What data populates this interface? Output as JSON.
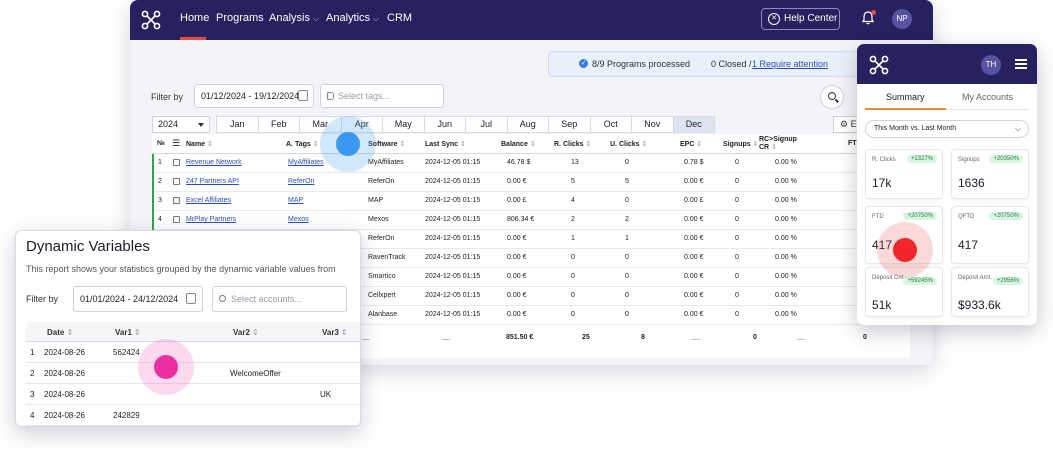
{
  "topnav": {
    "items": [
      {
        "label": "Home",
        "dropdown": false
      },
      {
        "label": "Programs",
        "dropdown": false
      },
      {
        "label": "Analysis",
        "dropdown": true
      },
      {
        "label": "Analytics",
        "dropdown": true
      },
      {
        "label": "CRM",
        "dropdown": false
      }
    ],
    "help_label": "Help Center",
    "avatar_initials": "NP",
    "nav_bg": "#26215f",
    "accent": "#e74b3c"
  },
  "status": {
    "processed": "8/9 Programs processed",
    "closed": "0 Closed /",
    "attention": "1 Require attention"
  },
  "filters": {
    "label": "Filter by",
    "date_range": "01/12/2024 - 19/12/2024",
    "tags_placeholder": "Select tags...",
    "year": "2024"
  },
  "months": [
    "Jan",
    "Feb",
    "Mar",
    "Apr",
    "May",
    "Jun",
    "Jul",
    "Aug",
    "Sep",
    "Oct",
    "Nov",
    "Dec"
  ],
  "active_month": "Dec",
  "export_label": "E",
  "table": {
    "headers": {
      "num": "№",
      "name": "Name",
      "tags": "A. Tags",
      "software": "Software",
      "sync": "Last Sync",
      "balance": "Balance",
      "rclicks": "R. Clicks",
      "uclicks": "U. Clicks",
      "epc": "EPC",
      "signups": "Signups",
      "rccr": "RC>Signup CR",
      "ftd": "FTD"
    },
    "rows": [
      {
        "n": "1",
        "name": "Revenue Network",
        "tag": "MyAffiliates",
        "software": "MyAffiliates",
        "sync": "2024-12-05 01:15",
        "balance": "46.78 $",
        "rclicks": "13",
        "uclicks": "0",
        "epc": "0.78 $",
        "signups": "0",
        "cr": "0.00 %",
        "checkbox": true
      },
      {
        "n": "2",
        "name": "247 Partners API",
        "tag": "ReferOn",
        "software": "ReferOn",
        "sync": "2024-12-05 01:15",
        "balance": "0.00 €",
        "rclicks": "5",
        "uclicks": "5",
        "epc": "0.00 €",
        "signups": "0",
        "cr": "0.00 %",
        "checkbox": true
      },
      {
        "n": "3",
        "name": "Excel Affiliates",
        "tag": "MAP",
        "software": "MAP",
        "sync": "2024-12-05 01:15",
        "balance": "0.00 £",
        "rclicks": "4",
        "uclicks": "0",
        "epc": "0.00 £",
        "signups": "0",
        "cr": "0.00 %",
        "checkbox": true
      },
      {
        "n": "4",
        "name": "MrPlay Partners",
        "tag": "Mexos",
        "software": "Mexos",
        "sync": "2024-12-05 01:15",
        "balance": "806.34 €",
        "rclicks": "2",
        "uclicks": "2",
        "epc": "0.00 €",
        "signups": "0",
        "cr": "0.00 %",
        "checkbox": true
      },
      {
        "n": "",
        "name": "",
        "tag": "",
        "software": "ReferOn",
        "sync": "2024-12-05 01:15",
        "balance": "0.00 €",
        "rclicks": "1",
        "uclicks": "1",
        "epc": "0.00 €",
        "signups": "0",
        "cr": "0.00 %",
        "checkbox": false
      },
      {
        "n": "",
        "name": "",
        "tag": "",
        "software": "RavenTrack",
        "sync": "2024-12-05 01:15",
        "balance": "0.00 €",
        "rclicks": "0",
        "uclicks": "0",
        "epc": "0.00 €",
        "signups": "0",
        "cr": "0.00 %",
        "checkbox": false
      },
      {
        "n": "",
        "name": "",
        "tag": "",
        "software": "Smartico",
        "sync": "2024-12-05 01:15",
        "balance": "0.00 €",
        "rclicks": "0",
        "uclicks": "0",
        "epc": "0.00 €",
        "signups": "0",
        "cr": "0.00 %",
        "checkbox": false
      },
      {
        "n": "",
        "name": "",
        "tag": "",
        "software": "Cellxpert",
        "sync": "2024-12-05 01:15",
        "balance": "0.00 €",
        "rclicks": "0",
        "uclicks": "0",
        "epc": "0.00 €",
        "signups": "0",
        "cr": "0.00 %",
        "checkbox": false
      },
      {
        "n": "",
        "name": "",
        "tag": "",
        "software": "Alanbase",
        "sync": "2024-12-05 01:15",
        "balance": "0.00 €",
        "rclicks": "0",
        "uclicks": "0",
        "epc": "0.00 €",
        "signups": "0",
        "cr": "0.00 %",
        "checkbox": false
      }
    ],
    "totals": {
      "dash1": "__",
      "dash2": "__",
      "balance": "851.50 €",
      "rclicks": "25",
      "uclicks": "8",
      "epc": "__",
      "signups": "0",
      "cr": "__",
      "ftd": "0"
    }
  },
  "dynamic": {
    "title": "Dynamic Variables",
    "description": "This report shows your statistics grouped by the dynamic variable values from",
    "filter_label": "Filter by",
    "date_range": "01/01/2024 - 24/12/2024",
    "accounts_placeholder": "Select accounts...",
    "headers": {
      "date": "Date",
      "var1": "Var1",
      "var2": "Var2",
      "var3": "Var3"
    },
    "rows": [
      {
        "n": "1",
        "date": "2024-08-26",
        "var1": "562424",
        "var2": "",
        "var3": ""
      },
      {
        "n": "2",
        "date": "2024-08-26",
        "var1": "",
        "var2": "WelcomeOffer",
        "var3": ""
      },
      {
        "n": "3",
        "date": "2024-08-26",
        "var1": "",
        "var2": "",
        "var3": "UK"
      },
      {
        "n": "4",
        "date": "2024-08-26",
        "var1": "242829",
        "var2": "",
        "var3": ""
      }
    ]
  },
  "mobile": {
    "avatar_initials": "TH",
    "tabs": [
      "Summary",
      "My Accounts"
    ],
    "period": "This Month vs. Last Month",
    "kpis": [
      {
        "label": "R. Clicks",
        "badge": "+1327%",
        "value": "17k"
      },
      {
        "label": "Signups",
        "badge": "+20350%",
        "value": "1636"
      },
      {
        "label": "FTD",
        "badge": "+20750%",
        "value": "417"
      },
      {
        "label": "QFTD",
        "badge": "+20750%",
        "value": "417"
      },
      {
        "label": "Deposit Cnt.",
        "badge": "+59245%",
        "value": "51k"
      },
      {
        "label": "Deposit Amt.",
        "badge": "+2956%",
        "value": "$933.6k"
      }
    ]
  }
}
